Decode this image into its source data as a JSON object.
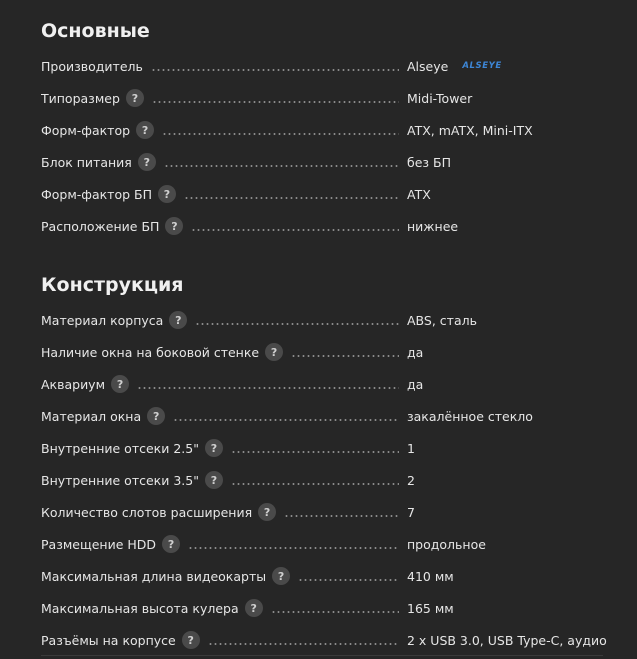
{
  "sections": [
    {
      "title": "Основные",
      "rows": [
        {
          "label": "Производитель",
          "value": "Alseye",
          "help": false,
          "logo": "ALSEYE"
        },
        {
          "label": "Типоразмер",
          "value": "Midi-Tower",
          "help": true
        },
        {
          "label": "Форм-фактор",
          "value": "ATX, mATX, Mini-ITX",
          "help": true
        },
        {
          "label": "Блок питания",
          "value": "без БП",
          "help": true
        },
        {
          "label": "Форм-фактор БП",
          "value": "ATX",
          "help": true
        },
        {
          "label": "Расположение БП",
          "value": "нижнее",
          "help": true
        }
      ]
    },
    {
      "title": "Конструкция",
      "rows": [
        {
          "label": "Материал корпуса",
          "value": "ABS, сталь",
          "help": true
        },
        {
          "label": "Наличие окна на боковой стенке",
          "value": "да",
          "help": true
        },
        {
          "label": "Аквариум",
          "value": "да",
          "help": true
        },
        {
          "label": "Материал окна",
          "value": "закалённое стекло",
          "help": true
        },
        {
          "label": "Внутренние отсеки 2.5\"",
          "value": "1",
          "help": true
        },
        {
          "label": "Внутренние отсеки 3.5\"",
          "value": "2",
          "help": true
        },
        {
          "label": "Количество слотов расширения",
          "value": "7",
          "help": true
        },
        {
          "label": "Размещение HDD",
          "value": "продольное",
          "help": true
        },
        {
          "label": "Максимальная длина видеокарты",
          "value": "410 мм",
          "help": true
        },
        {
          "label": "Максимальная высота кулера",
          "value": "165 мм",
          "help": true
        },
        {
          "label": "Разъёмы на корпусе",
          "value": "2 x USB 3.0, USB Type-C, аудио",
          "help": true
        }
      ]
    }
  ],
  "help_icon_glyph": "?",
  "colors": {
    "background": "#262626",
    "text": "#e6e6e6",
    "help_icon_bg": "#4a4a4a",
    "brand_logo": "#3d86d6"
  }
}
